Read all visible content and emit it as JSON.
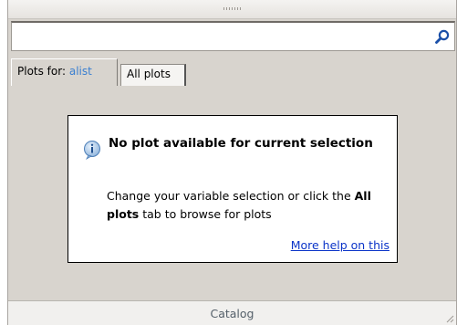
{
  "search": {
    "value": "",
    "placeholder": "",
    "icon": "search-icon"
  },
  "tabs": [
    {
      "prefix": "Plots for: ",
      "variable": "alist",
      "active": true
    },
    {
      "label": "All plots",
      "active": false
    }
  ],
  "message": {
    "icon": "info-icon",
    "title": "No plot available for current selection",
    "body_start": "Change your variable selection or click the ",
    "body_bold": "All plots",
    "body_end": " tab to browse for plots",
    "help_link": "More help on this"
  },
  "footer": {
    "label": "Catalog"
  },
  "colors": {
    "panel_bg": "#d8d4ce",
    "link": "#0b34c8",
    "variable": "#3a7fd0",
    "footer_text": "#55606a"
  }
}
